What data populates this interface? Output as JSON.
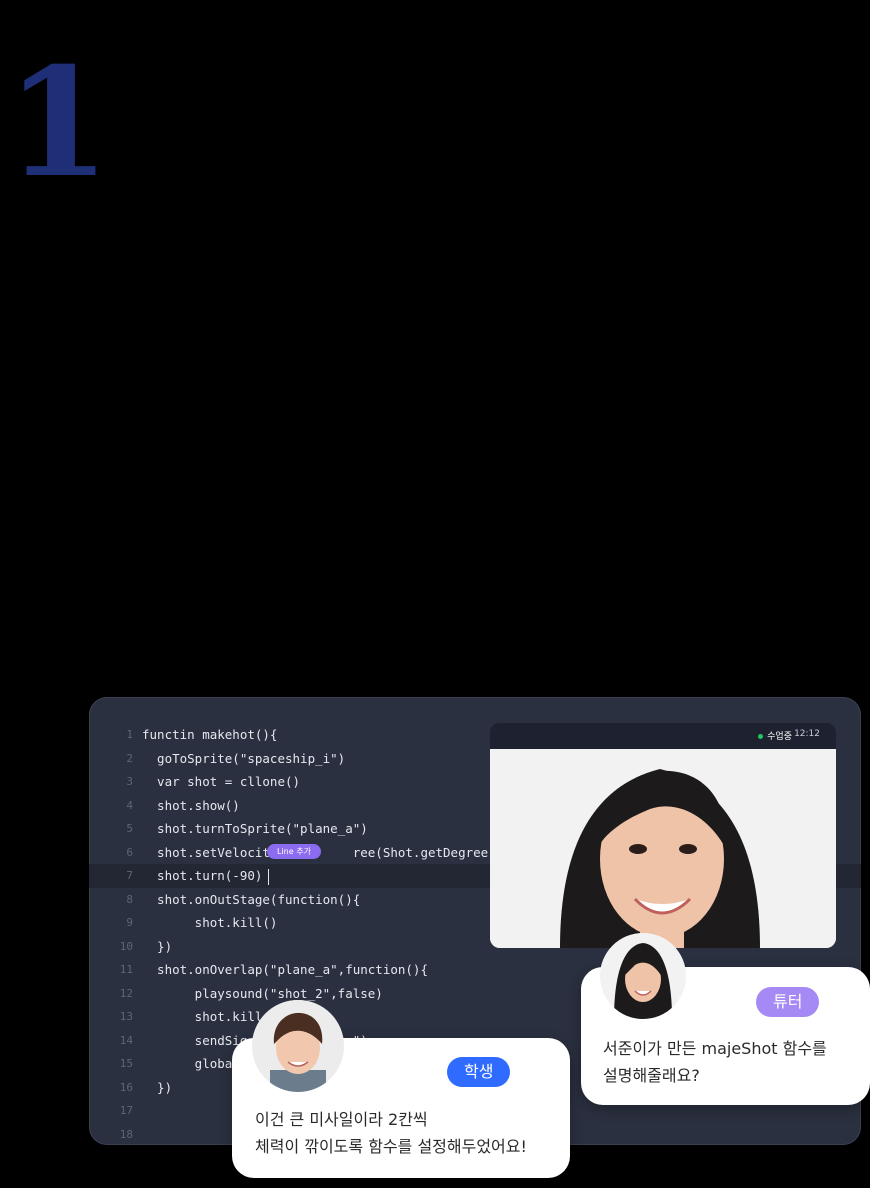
{
  "step_number": "1",
  "editor": {
    "highlight_tag": "Line 추가",
    "lines": [
      {
        "n": "1",
        "code": "functin makehot(){"
      },
      {
        "n": "2",
        "code": "  goToSprite(\"spaceship_i\")"
      },
      {
        "n": "3",
        "code": "  var shot = cllone()"
      },
      {
        "n": "4",
        "code": "  shot.show()"
      },
      {
        "n": "5",
        "code": "  shot.turnToSprite(\"plane_a\")"
      },
      {
        "n": "6",
        "code": "  shot.setVelocit           ree(Shot.getDegree(),"
      },
      {
        "n": "7",
        "code": "  shot.turn(-90)"
      },
      {
        "n": "8",
        "code": "  shot.onOutStage(function(){"
      },
      {
        "n": "9",
        "code": "       shot.kill()"
      },
      {
        "n": "10",
        "code": "  })"
      },
      {
        "n": "11",
        "code": "  shot.onOverlap(\"plane_a\",function(){"
      },
      {
        "n": "12",
        "code": "       playsound(\"shot_2\",false)"
      },
      {
        "n": "13",
        "code": "       shot.kill"
      },
      {
        "n": "14",
        "code": "       sendSig              \")"
      },
      {
        "n": "15",
        "code": "       global"
      },
      {
        "n": "16",
        "code": "  })"
      },
      {
        "n": "17",
        "code": ""
      },
      {
        "n": "18",
        "code": ""
      }
    ]
  },
  "video": {
    "status": "수업중",
    "time": "12:12"
  },
  "tutor_bubble": {
    "role": "튜터",
    "message": "서준이가 만든 majeShot 함수를\n설명해줄래요?",
    "role_color": "#a58af5"
  },
  "student_bubble": {
    "role": "학생",
    "message": "이건 큰 미사일이라 2칸씩\n체력이 깎이도록 함수를 설정해두었어요!",
    "role_color": "#2f6bff"
  },
  "colors": {
    "accent_number": "#1e2f78",
    "editor_bg": "#2b3040"
  }
}
